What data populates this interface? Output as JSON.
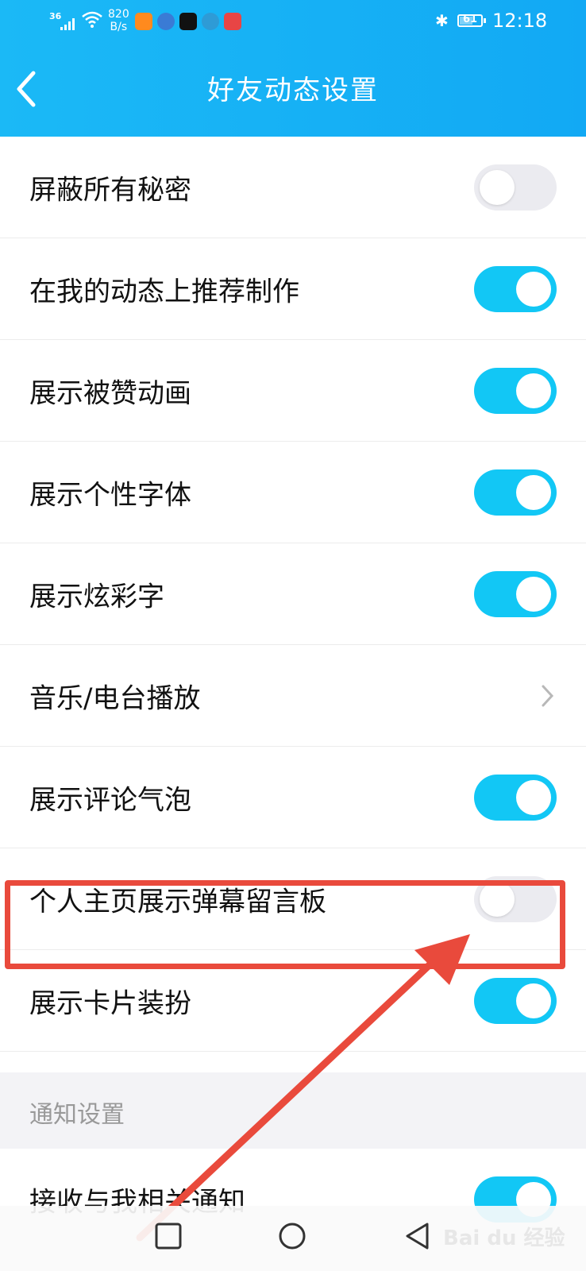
{
  "status_bar": {
    "signal": "36",
    "net_speed_value": "820",
    "net_speed_unit": "B/s",
    "battery": "61",
    "battery_level": 0.61,
    "time": "12:18"
  },
  "header": {
    "title": "好友动态设置",
    "back_icon": "chevron-left-icon"
  },
  "settings": [
    {
      "label": "屏蔽所有秘密",
      "state": "off"
    },
    {
      "label": "在我的动态上推荐制作",
      "state": "on"
    },
    {
      "label": "展示被赞动画",
      "state": "on"
    },
    {
      "label": "展示个性字体",
      "state": "on"
    },
    {
      "label": "展示炫彩字",
      "state": "on"
    },
    {
      "label": "音乐/电台播放",
      "state": "chevron"
    },
    {
      "label": "展示评论气泡",
      "state": "on"
    },
    {
      "label": "个人主页展示弹幕留言板",
      "state": "off"
    },
    {
      "label": "展示卡片装扮",
      "state": "on"
    }
  ],
  "notification_section": {
    "title": "通知设置",
    "items": [
      {
        "label": "接收与我相关通知",
        "state": "on"
      }
    ]
  },
  "colors": {
    "header": "#16b3f5",
    "toggle_on": "#12c7f5",
    "toggle_off": "#ebebf0",
    "highlight": "#e94a3c"
  },
  "nav_icons": [
    "square-icon",
    "circle-icon",
    "triangle-back-icon"
  ],
  "watermark": "Bai du 经验"
}
